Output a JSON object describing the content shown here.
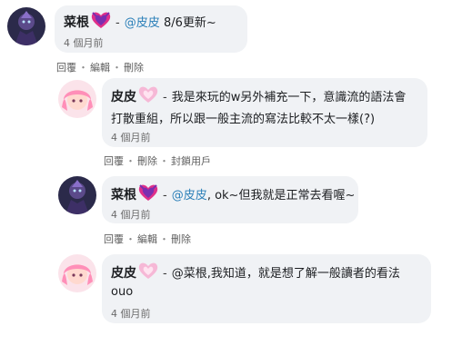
{
  "comments": [
    {
      "author": "菜根",
      "badge": "heart-badge-pink-purple",
      "dash": "-",
      "mention": "@皮皮",
      "text": " 8/6更新~",
      "time": "4 個月前",
      "actions": [
        "回覆",
        "編輯",
        "刪除"
      ]
    },
    {
      "author": "皮皮",
      "badge": "heart-badge-pink",
      "dash": "-",
      "text_line1": "我是來玩的w另外補充一下，意識流的語法會",
      "text_line2": "打散重組，所以跟一般主流的寫法比較不太一樣(?)",
      "time": "4 個月前",
      "actions": [
        "回覆",
        "刪除",
        "封鎖用戶"
      ]
    },
    {
      "author": "菜根",
      "badge": "heart-badge-pink-purple",
      "dash": "-",
      "mention": "@皮皮",
      "text": ", ok~但我就是正常去看喔~",
      "time": "4 個月前",
      "actions": [
        "回覆",
        "編輯",
        "刪除"
      ]
    },
    {
      "author": "皮皮",
      "badge": "heart-badge-pink",
      "dash": "-",
      "text_line1": "@菜根,我知道，就是想了解一般讀者的看法",
      "text_line2": "ouo",
      "time": "4 個月前"
    }
  ],
  "action_separator": "・",
  "colors": {
    "mention": "#2a7fb8",
    "bubble": "#f0f2f5"
  }
}
